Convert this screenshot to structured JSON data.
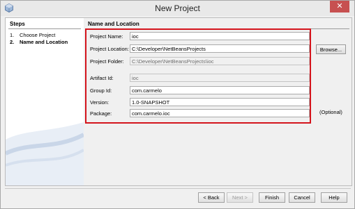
{
  "window": {
    "title": "New Project",
    "close_glyph": "✕"
  },
  "steps": {
    "title": "Steps",
    "items": [
      {
        "num": "1.",
        "label": "Choose Project"
      },
      {
        "num": "2.",
        "label": "Name and Location"
      }
    ]
  },
  "section": {
    "title": "Name and Location"
  },
  "form": {
    "project_name_label": "Project Name:",
    "project_name_value": "ioc",
    "project_location_label": "Project Location:",
    "project_location_value": "C:\\Developer\\NetBeansProjects",
    "browse_label": "Browse...",
    "project_folder_label": "Project Folder:",
    "project_folder_value": "C:\\Developer\\NetBeansProjects\\ioc",
    "artifact_id_label": "Artifact Id:",
    "artifact_id_value": "ioc",
    "group_id_label": "Group Id:",
    "group_id_value": "com.carmelo",
    "version_label": "Version:",
    "version_value": "1.0-SNAPSHOT",
    "package_label": "Package:",
    "package_value": "com.carmelo.ioc",
    "optional_label": "(Optional)"
  },
  "buttons": {
    "back": "< Back",
    "next": "Next >",
    "finish": "Finish",
    "cancel": "Cancel",
    "help": "Help"
  },
  "colors": {
    "highlight_box": "#d4141c",
    "close_button": "#c75050"
  }
}
